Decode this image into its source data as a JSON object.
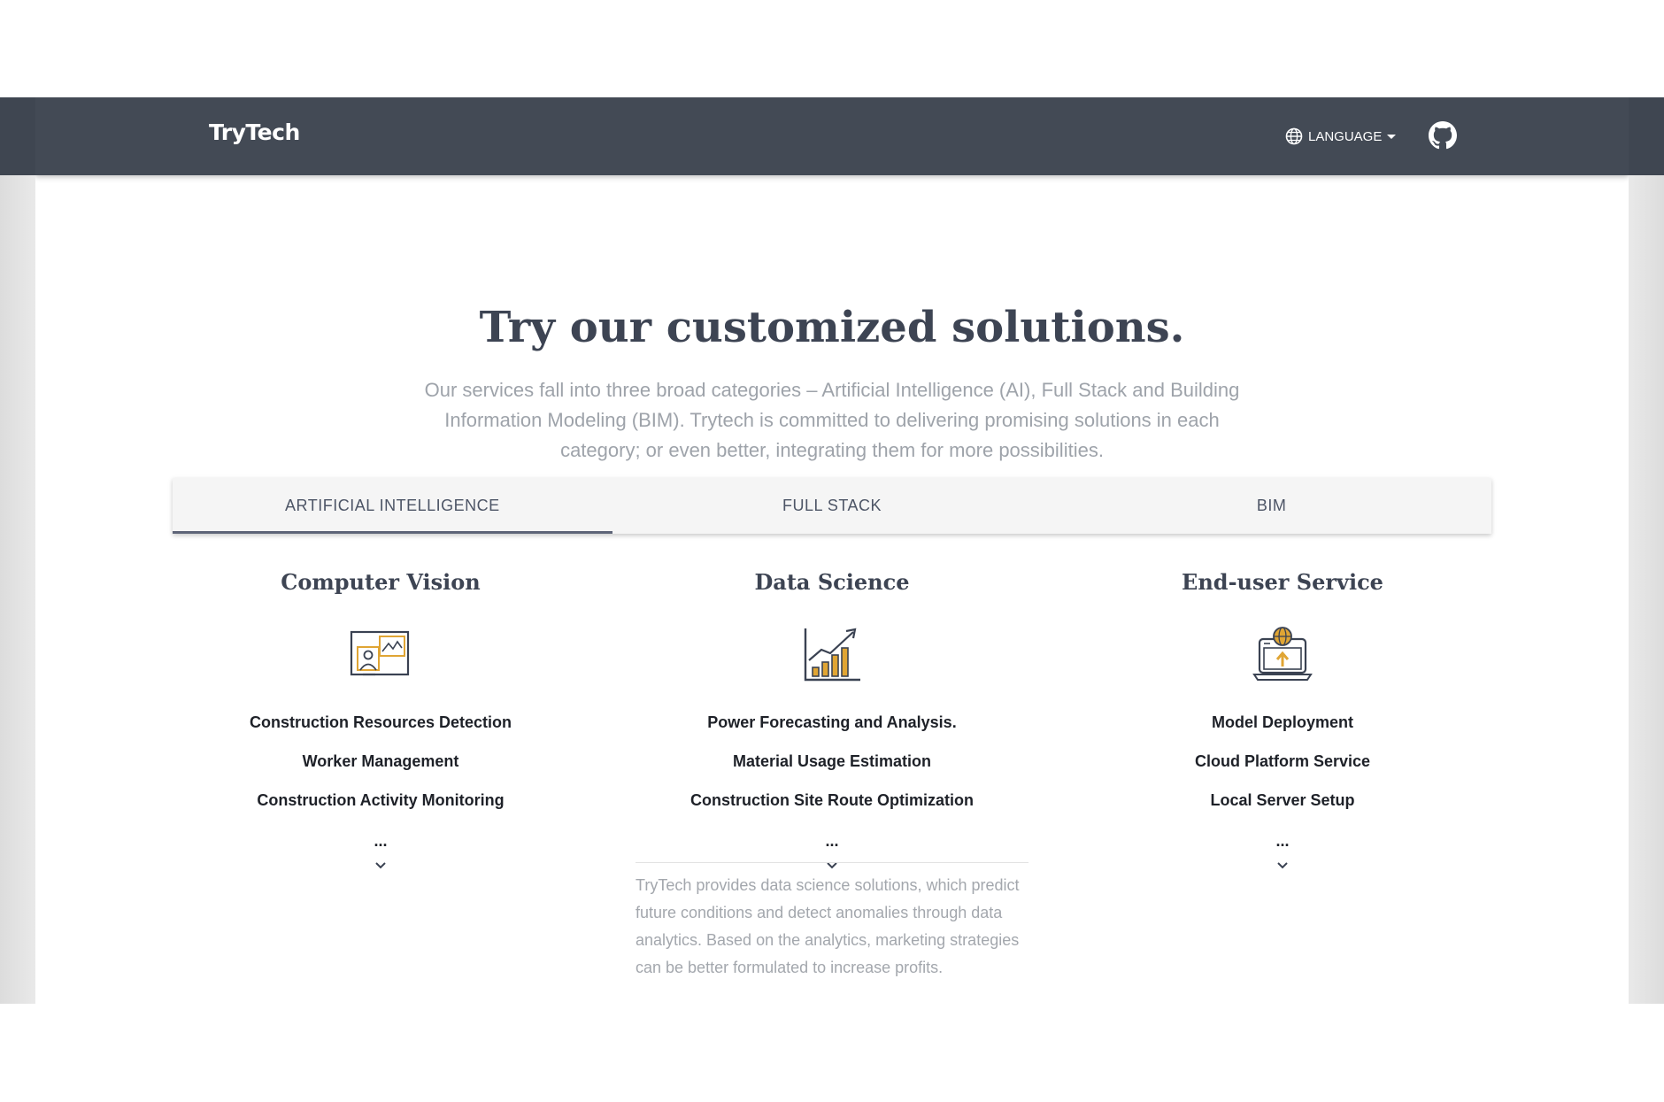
{
  "navbar": {
    "brand": "TryTech",
    "language_label": "LANGUAGE"
  },
  "hero": {
    "title": "Try our customized solutions.",
    "lead": "Our services fall into three broad categories – Artificial Intelligence (AI), Full Stack and Building Information Modeling (BIM). Trytech is committed to delivering promising solutions in each category; or even better, integrating them for more possibilities."
  },
  "tabs": [
    {
      "label": "ARTIFICIAL INTELLIGENCE",
      "active": true
    },
    {
      "label": "FULL STACK",
      "active": false
    },
    {
      "label": "BIM",
      "active": false
    }
  ],
  "columns": [
    {
      "title": "Computer Vision",
      "icon": "computer-vision-icon",
      "items": [
        "Construction Resources Detection",
        "Worker Management",
        "Construction Activity Monitoring"
      ],
      "more": "..."
    },
    {
      "title": "Data Science",
      "icon": "growth-chart-icon",
      "items": [
        "Power Forecasting and Analysis.",
        "Material Usage Estimation",
        "Construction Site Route Optimization"
      ],
      "more": "...",
      "expanded_text": "TryTech provides data science solutions, which predict future conditions and detect anomalies through data analytics. Based on the analytics, marketing strategies can be better formulated to increase profits."
    },
    {
      "title": "End-user Service",
      "icon": "laptop-upload-icon",
      "items": [
        "Model Deployment",
        "Cloud Platform Service",
        "Local Server Setup"
      ],
      "more": "..."
    }
  ],
  "colors": {
    "navbar": "#434a55",
    "heading": "#3d4453",
    "muted_text": "#9ea3aa",
    "tab_bg": "#f5f5f5",
    "tab_indicator": "#5e6578",
    "icon_accent": "#e0a534",
    "icon_stroke": "#3a4252"
  }
}
